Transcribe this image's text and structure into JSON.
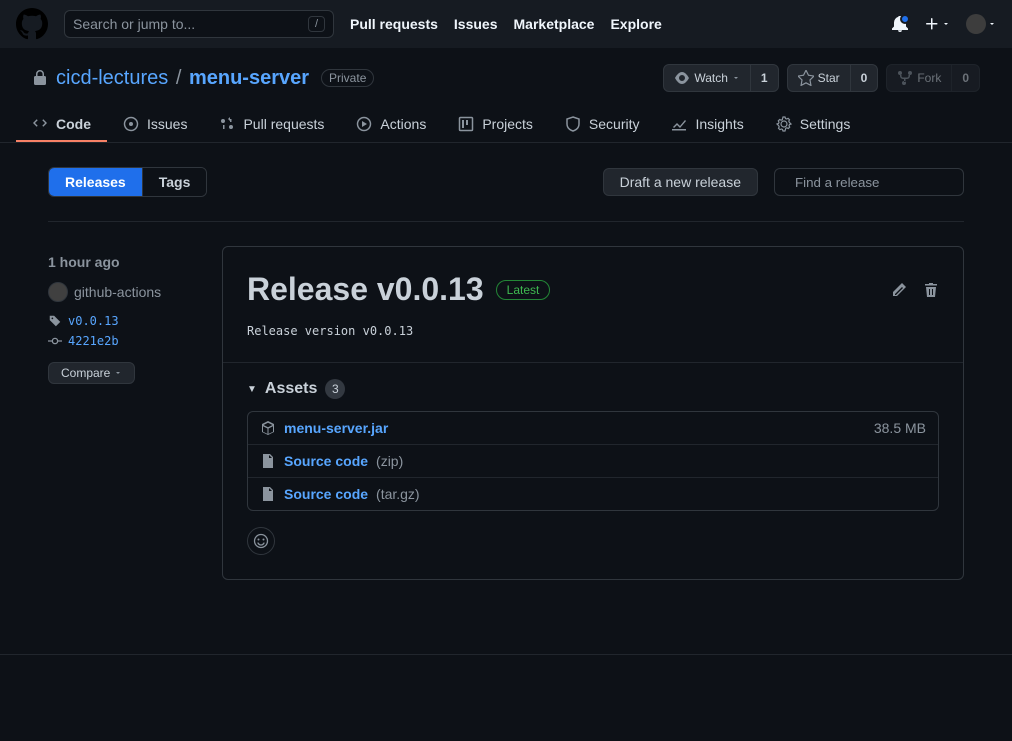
{
  "header": {
    "search_placeholder": "Search or jump to...",
    "slash": "/",
    "nav": [
      "Pull requests",
      "Issues",
      "Marketplace",
      "Explore"
    ]
  },
  "repo": {
    "owner": "cicd-lectures",
    "name": "menu-server",
    "visibility": "Private",
    "actions": {
      "watch_label": "Watch",
      "watch_count": "1",
      "star_label": "Star",
      "star_count": "0",
      "fork_label": "Fork",
      "fork_count": "0"
    }
  },
  "tabs": {
    "code": "Code",
    "issues": "Issues",
    "pulls": "Pull requests",
    "actions": "Actions",
    "projects": "Projects",
    "security": "Security",
    "insights": "Insights",
    "settings": "Settings"
  },
  "subnav": {
    "releases": "Releases",
    "tags": "Tags",
    "draft": "Draft a new release",
    "find_placeholder": "Find a release"
  },
  "release": {
    "time": "1 hour ago",
    "author": "github-actions",
    "tag": "v0.0.13",
    "commit": "4221e2b",
    "compare": "Compare",
    "title": "Release v0.0.13",
    "latest": "Latest",
    "description": "Release version v0.0.13",
    "assets_label": "Assets",
    "assets_count": "3",
    "assets": [
      {
        "name": "menu-server.jar",
        "suffix": "",
        "size": "38.5 MB"
      },
      {
        "name": "Source code",
        "suffix": "(zip)",
        "size": ""
      },
      {
        "name": "Source code",
        "suffix": "(tar.gz)",
        "size": ""
      }
    ]
  }
}
